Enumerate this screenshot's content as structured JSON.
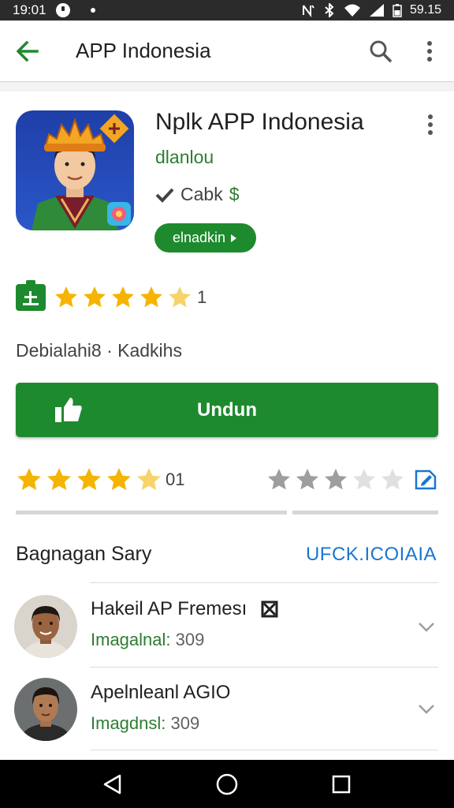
{
  "status_bar": {
    "time": "19:01",
    "battery": "59.15"
  },
  "app_bar": {
    "title": "APP Indonesia",
    "back_icon": "arrow-back-icon",
    "search_icon": "search-icon",
    "overflow_icon": "more-vert-icon"
  },
  "app": {
    "name": "Nplk APP Indonesia",
    "developer": "dlanlou",
    "price_label": "Cabk",
    "price_suffix": "$",
    "chip_label": "elnadkin",
    "rating_count": "1",
    "stars_filled": 4,
    "meta": "Debialahi8 · Kadkihs"
  },
  "install": {
    "label": "Undun"
  },
  "rating_row": {
    "count": "01",
    "stars_filled": 4,
    "user_stars_filled": 3
  },
  "reviews_section": {
    "title": "Bagnagan Sary",
    "link": "UFCK.ICOIAIA",
    "items": [
      {
        "name": "Hakeil AP Fremesı",
        "meta_label": "Imagalnal:",
        "meta_value": "309"
      },
      {
        "name": "Apelnleanl AGIO",
        "meta_label": "Imagdnsl:",
        "meta_value": "309"
      }
    ]
  },
  "colors": {
    "primary_green": "#1e8a2e",
    "text_green": "#2e7d32",
    "link_blue": "#1976d2",
    "star_gold": "#f5b400"
  }
}
